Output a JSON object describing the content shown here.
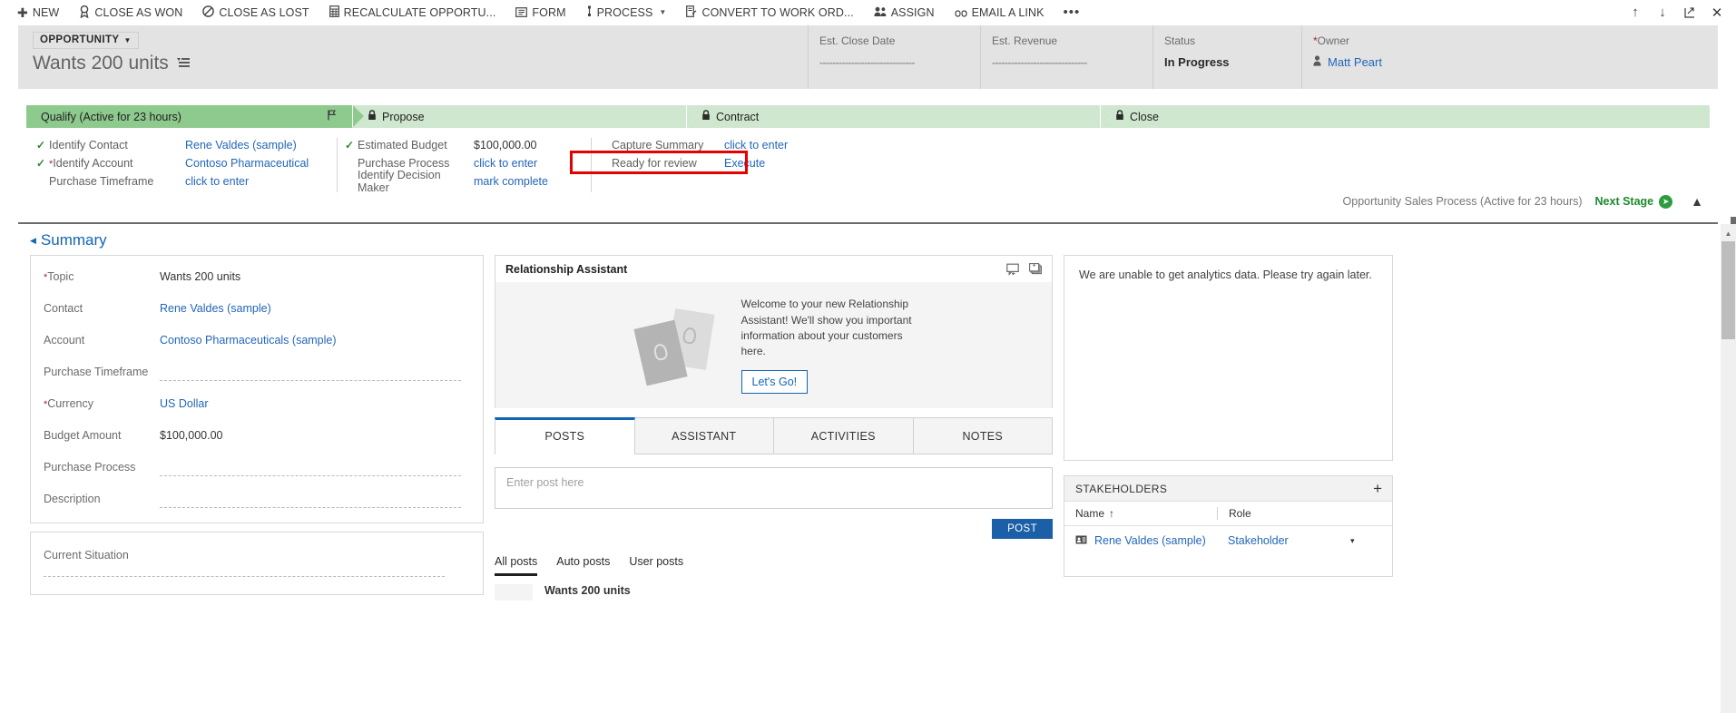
{
  "command_bar": {
    "items": [
      {
        "label": "NEW",
        "icon": "plus-icon",
        "glyph": "✚",
        "caret": false
      },
      {
        "label": "CLOSE AS WON",
        "icon": "award-icon",
        "glyph": "🏅",
        "caret": false
      },
      {
        "label": "CLOSE AS LOST",
        "icon": "prohibited-icon",
        "glyph": "⦸",
        "caret": false
      },
      {
        "label": "RECALCULATE OPPORTU...",
        "icon": "calculator-icon",
        "glyph": "▤",
        "caret": false
      },
      {
        "label": "FORM",
        "icon": "form-icon",
        "glyph": "▤",
        "caret": false
      },
      {
        "label": "PROCESS",
        "icon": "process-icon",
        "glyph": "⇅",
        "caret": true
      },
      {
        "label": "CONVERT TO WORK ORD...",
        "icon": "convert-work-order-icon",
        "glyph": "🗒",
        "caret": false
      },
      {
        "label": "ASSIGN",
        "icon": "assign-people-icon",
        "glyph": "👥",
        "caret": false
      },
      {
        "label": "EMAIL A LINK",
        "icon": "link-icon",
        "glyph": "∞",
        "caret": false
      }
    ],
    "overflow_label": "•••",
    "right_icons": [
      {
        "name": "previous-record-icon",
        "glyph": "↑"
      },
      {
        "name": "next-record-icon",
        "glyph": "↓"
      },
      {
        "name": "popout-icon",
        "glyph": "⇱"
      },
      {
        "name": "close-icon",
        "glyph": "✕"
      }
    ]
  },
  "header": {
    "entity_type": "OPPORTUNITY",
    "entity_caret": "▾",
    "record_title": "Wants 200 units",
    "title_menu_icon": "title-options-icon",
    "fields": [
      {
        "label": "Est. Close Date",
        "value": "",
        "empty": true,
        "required": false,
        "width": "wide"
      },
      {
        "label": "Est. Revenue",
        "value": "",
        "empty": true,
        "required": false,
        "width": "wide"
      },
      {
        "label": "Status",
        "value": "In Progress",
        "empty": false,
        "required": false,
        "width": "normal"
      },
      {
        "label": "Owner",
        "value": "Matt Peart",
        "empty": false,
        "required": true,
        "width": "normal",
        "is_link": true
      }
    ]
  },
  "business_process": {
    "stages": [
      {
        "label": "Qualify (Active for 23 hours)",
        "active": true,
        "locked": false,
        "flag": true
      },
      {
        "label": "Propose",
        "active": false,
        "locked": true,
        "flag": false
      },
      {
        "label": "Contract",
        "active": false,
        "locked": true,
        "flag": false
      },
      {
        "label": "Close",
        "active": false,
        "locked": true,
        "flag": false
      }
    ],
    "step_groups": [
      {
        "steps": [
          {
            "check": true,
            "required": false,
            "name": "Identify Contact",
            "value": "Rene Valdes (sample)",
            "link": true
          },
          {
            "check": true,
            "required": true,
            "name": "Identify Account",
            "value": "Contoso Pharmaceutical",
            "link": true
          },
          {
            "check": false,
            "required": false,
            "name": "Purchase Timeframe",
            "value": "click to enter",
            "link": true
          }
        ]
      },
      {
        "steps": [
          {
            "check": true,
            "required": false,
            "name": "Estimated Budget",
            "value": "$100,000.00",
            "link": false
          },
          {
            "check": false,
            "required": false,
            "name": "Purchase Process",
            "value": "click to enter",
            "link": true
          },
          {
            "check": false,
            "required": false,
            "name": "Identify Decision Maker",
            "value": "mark complete",
            "link": true
          }
        ]
      },
      {
        "steps": [
          {
            "check": false,
            "required": false,
            "name": "Capture Summary",
            "value": "click to enter",
            "link": true
          },
          {
            "check": false,
            "required": false,
            "name": "Ready for review",
            "value": "Execute",
            "link": true
          }
        ]
      }
    ],
    "process_name": "Opportunity Sales Process (Active for 23 hours)",
    "next_stage_label": "Next Stage",
    "collapse_icon": "chevron-up-icon"
  },
  "summary": {
    "section_title": "Summary",
    "fields": [
      {
        "label": "Topic",
        "value": "Wants 200 units",
        "required": true,
        "empty": false,
        "link": false
      },
      {
        "label": "Contact",
        "value": "Rene Valdes (sample)",
        "required": false,
        "empty": false,
        "link": true
      },
      {
        "label": "Account",
        "value": "Contoso Pharmaceuticals (sample)",
        "required": false,
        "empty": false,
        "link": true
      },
      {
        "label": "Purchase Timeframe",
        "value": "",
        "required": false,
        "empty": true,
        "link": false
      },
      {
        "label": "Currency",
        "value": "US Dollar",
        "required": true,
        "empty": false,
        "link": true
      },
      {
        "label": "Budget Amount",
        "value": "$100,000.00",
        "required": false,
        "empty": false,
        "link": false
      },
      {
        "label": "Purchase Process",
        "value": "",
        "required": false,
        "empty": true,
        "link": false
      },
      {
        "label": "Description",
        "value": "",
        "required": false,
        "empty": true,
        "link": false
      }
    ],
    "current_situation_label": "Current Situation",
    "current_situation_value": ""
  },
  "relationship_assistant": {
    "title": "Relationship Assistant",
    "icons": [
      {
        "name": "card-feedback-icon"
      },
      {
        "name": "stack-cards-icon"
      }
    ],
    "welcome_text": "Welcome to your new Relationship Assistant! We'll show you important information about your customers here.",
    "cta_label": "Let's Go!"
  },
  "social_pane": {
    "tabs": [
      {
        "label": "POSTS",
        "active": true
      },
      {
        "label": "ASSISTANT",
        "active": false
      },
      {
        "label": "ACTIVITIES",
        "active": false
      },
      {
        "label": "NOTES",
        "active": false
      }
    ],
    "post_placeholder": "Enter post here",
    "post_button": "POST",
    "filters": [
      {
        "label": "All posts",
        "active": true
      },
      {
        "label": "Auto posts",
        "active": false
      },
      {
        "label": "User posts",
        "active": false
      }
    ],
    "posts": [
      {
        "title": "Wants 200 units"
      }
    ]
  },
  "analytics": {
    "message": "We are unable to get analytics data. Please try again later."
  },
  "stakeholders": {
    "title": "STAKEHOLDERS",
    "add_icon": "plus-icon",
    "columns": [
      {
        "label": "Name",
        "sort": "↑"
      },
      {
        "label": "Role",
        "sort": ""
      },
      {
        "label": "",
        "sort": ""
      }
    ],
    "rows": [
      {
        "name": "Rene Valdes (sample)",
        "role": "Stakeholder",
        "icon": "contact-card-icon",
        "caret": "▾"
      }
    ]
  },
  "colors": {
    "accent_blue": "#1265b5",
    "link_blue": "#2266bb",
    "stage_active_green": "#8ec98e",
    "stage_inactive_green": "#cfe7cf",
    "next_stage_green": "#1d8a2e",
    "required_red": "#a4262c",
    "highlight_red": "#e60000",
    "post_button_blue": "#1a5fa8",
    "header_gray": "#e3e3e3"
  }
}
